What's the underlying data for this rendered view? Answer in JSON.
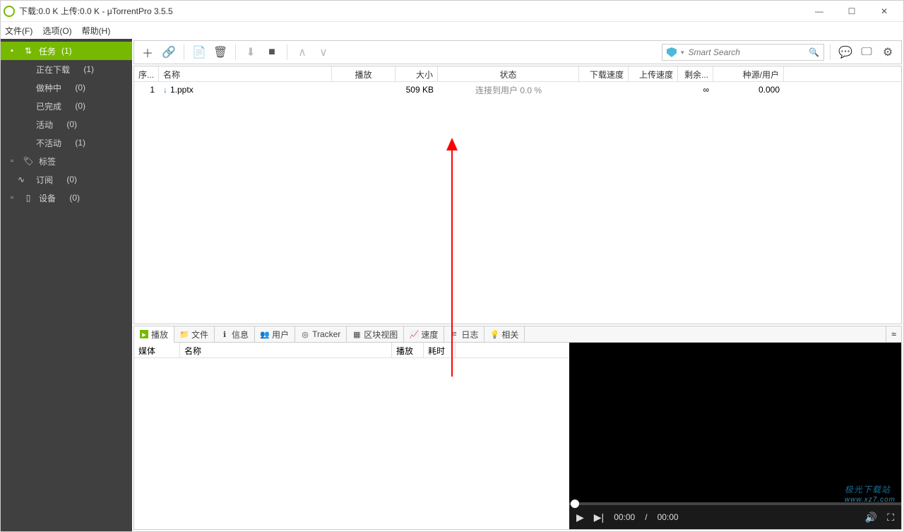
{
  "titlebar": {
    "text": "下载:0.0 K 上传:0.0 K - μTorrentPro 3.5.5"
  },
  "menu": {
    "file": "文件(F)",
    "options": "选项(O)",
    "help": "帮助(H)"
  },
  "sidebar": {
    "tasks": {
      "label": "任务",
      "count": "(1)"
    },
    "downloading": {
      "label": "正在下载",
      "count": "(1)"
    },
    "seeding": {
      "label": "做种中",
      "count": "(0)"
    },
    "completed": {
      "label": "已完成",
      "count": "(0)"
    },
    "active": {
      "label": "活动",
      "count": "(0)"
    },
    "inactive": {
      "label": "不活动",
      "count": "(1)"
    },
    "labels": {
      "label": "标签"
    },
    "feeds": {
      "label": "订阅",
      "count": "(0)"
    },
    "devices": {
      "label": "设备",
      "count": "(0)"
    }
  },
  "search": {
    "placeholder": "Smart Search"
  },
  "columns": {
    "seq": "序...",
    "name": "名称",
    "play": "播放",
    "size": "大小",
    "status": "状态",
    "down": "下载速度",
    "up": "上传速度",
    "eta": "剩余...",
    "seeds": "种源/用户"
  },
  "row": {
    "seq": "1",
    "name": "1.pptx",
    "size": "509 KB",
    "status": "连接到用户 0.0 %",
    "eta": "∞",
    "seeds": "0.000"
  },
  "tabs": {
    "play": "播放",
    "files": "文件",
    "info": "信息",
    "peers": "用户",
    "tracker": "Tracker",
    "pieces": "区块视图",
    "speed": "速度",
    "log": "日志",
    "related": "相关"
  },
  "lowerCols": {
    "media": "媒体",
    "name": "名称",
    "play": "播放",
    "elapsed": "耗时"
  },
  "player": {
    "cur": "00:00",
    "sep": "/",
    "dur": "00:00"
  },
  "watermark": {
    "main": "极光下载站",
    "sub": "www.xz7.com"
  }
}
